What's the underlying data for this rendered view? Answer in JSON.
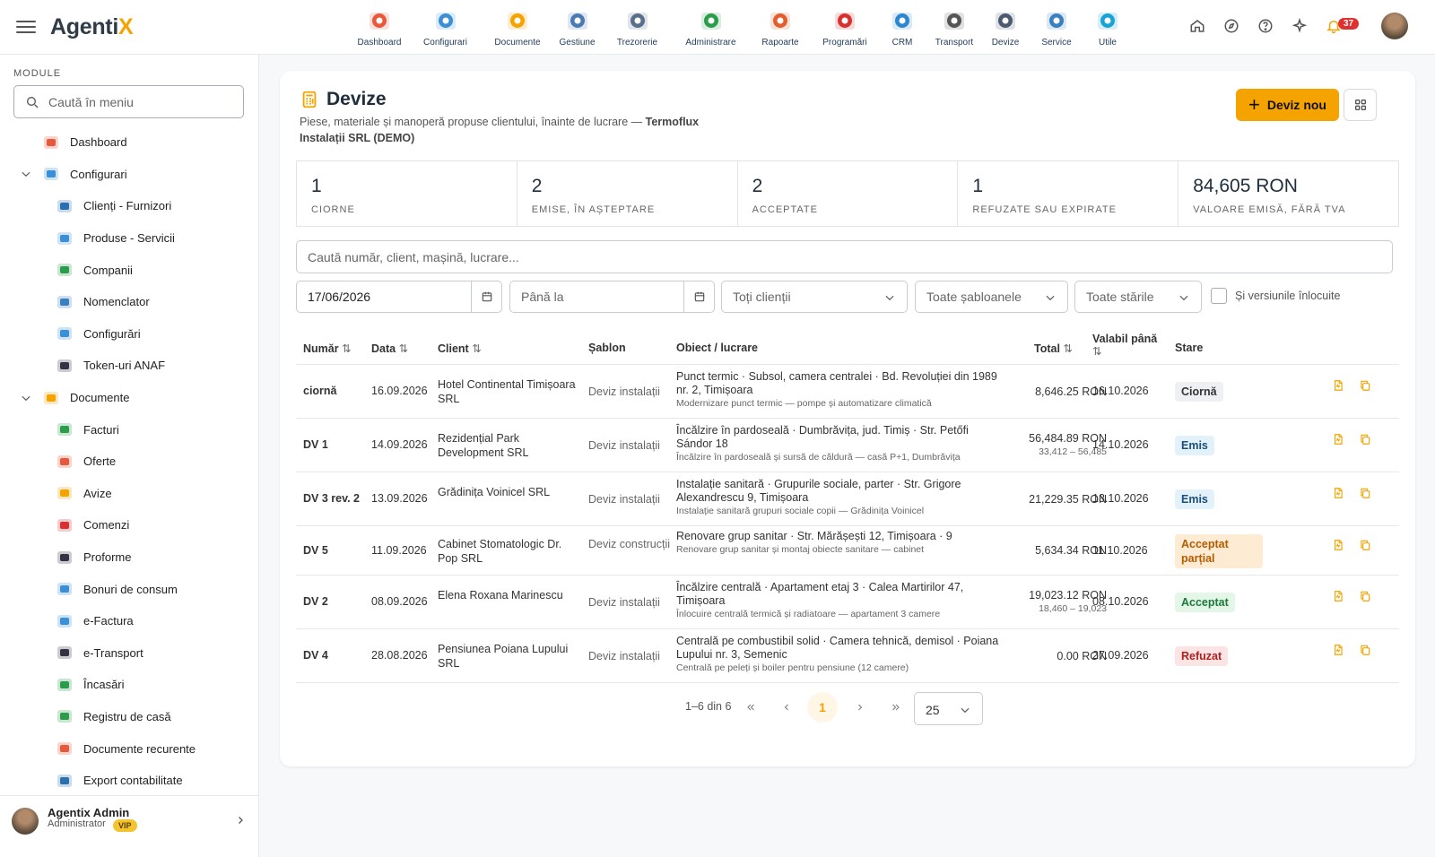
{
  "app": {
    "logo_main": "Agenti",
    "logo_x": "X"
  },
  "modules": [
    {
      "label": "Dashboard",
      "icon": "dashboard-chart-icon"
    },
    {
      "label": "Configurari",
      "icon": "wrench-gear-icon"
    },
    {
      "label": "Documente",
      "icon": "documents-icon"
    },
    {
      "label": "Gestiune",
      "icon": "warehouse-icon"
    },
    {
      "label": "Trezorerie",
      "icon": "bank-icon"
    },
    {
      "label": "Administrare",
      "icon": "shield-check-icon"
    },
    {
      "label": "Rapoarte",
      "icon": "report-pie-icon"
    },
    {
      "label": "Programări",
      "icon": "clock-icon"
    },
    {
      "label": "CRM",
      "icon": "crm-cycle-icon"
    },
    {
      "label": "Transport",
      "icon": "truck-icon"
    },
    {
      "label": "Devize",
      "icon": "estimate-doc-icon"
    },
    {
      "label": "Service",
      "icon": "car-service-icon"
    },
    {
      "label": "Utile",
      "icon": "help-circle-icon"
    }
  ],
  "notifications": {
    "count": "37"
  },
  "sidebar": {
    "heading": "MODULE",
    "search_placeholder": "Caută în meniu",
    "items": [
      {
        "label": "Dashboard",
        "level": "top"
      },
      {
        "label": "Configurari",
        "level": "group"
      },
      {
        "label": "Clienți - Furnizori",
        "level": "child"
      },
      {
        "label": "Produse - Servicii",
        "level": "child"
      },
      {
        "label": "Companii",
        "level": "child"
      },
      {
        "label": "Nomenclator",
        "level": "child"
      },
      {
        "label": "Configurări",
        "level": "child"
      },
      {
        "label": "Token-uri ANAF",
        "level": "child"
      },
      {
        "label": "Documente",
        "level": "group"
      },
      {
        "label": "Facturi",
        "level": "child"
      },
      {
        "label": "Oferte",
        "level": "child"
      },
      {
        "label": "Avize",
        "level": "child"
      },
      {
        "label": "Comenzi",
        "level": "child"
      },
      {
        "label": "Proforme",
        "level": "child"
      },
      {
        "label": "Bonuri de consum",
        "level": "child"
      },
      {
        "label": "e-Factura",
        "level": "child"
      },
      {
        "label": "e-Transport",
        "level": "child"
      },
      {
        "label": "Încasări",
        "level": "child"
      },
      {
        "label": "Registru de casă",
        "level": "child"
      },
      {
        "label": "Documente recurente",
        "level": "child"
      },
      {
        "label": "Export contabilitate",
        "level": "child"
      }
    ],
    "user": {
      "name": "Agentix Admin",
      "role": "Administrator",
      "badge": "VIP"
    }
  },
  "page": {
    "title": "Devize",
    "subtitle": "Piese, materiale și manoperă propuse clientului, înainte de lucrare —",
    "company": "Termoflux Instalații SRL (DEMO)",
    "new_button": "Deviz nou"
  },
  "stats": [
    {
      "value": "1",
      "label": "CIORNE"
    },
    {
      "value": "2",
      "label": "EMISE, ÎN AȘTEPTARE"
    },
    {
      "value": "2",
      "label": "ACCEPTATE"
    },
    {
      "value": "1",
      "label": "REFUZATE SAU EXPIRATE"
    },
    {
      "value": "84,605 RON",
      "label": "VALOARE EMISĂ, FĂRĂ TVA"
    }
  ],
  "search_placeholder": "Caută număr, client, mașină, lucrare...",
  "filters": {
    "date_from": "17/06/2026",
    "date_to_placeholder": "Până la",
    "clients": "Toți clienții",
    "templates": "Toate șabloanele",
    "states": "Toate stările",
    "replaced_label": "Și versiunile înlocuite"
  },
  "table": {
    "headers": {
      "num": "Număr",
      "date": "Data",
      "client": "Client",
      "template": "Șablon",
      "object": "Obiect / lucrare",
      "total": "Total",
      "valid1": "Valabil până",
      "state": "Stare"
    },
    "rows": [
      {
        "num": "ciornă",
        "date": "16.09.2026",
        "client": "Hotel Continental Timișoara SRL",
        "template": "Deviz instalații",
        "obj": "Punct termic · Subsol, camera centralei · Bd. Revoluției din 1989 nr. 2, Timișoara",
        "obj_sub": "Modernizare punct termic — pompe și automatizare climatică",
        "total": "8,646.25 RON",
        "total_sub": "",
        "valid": "16.10.2026",
        "state": "Ciornă",
        "state_bg": "#eef0f3",
        "state_fg": "#333"
      },
      {
        "num": "DV 1",
        "date": "14.09.2026",
        "client": "Rezidențial Park Development SRL",
        "template": "Deviz instalații",
        "obj": "Încălzire în pardoseală · Dumbrăvița, jud. Timiș · Str. Petőfi Sándor 18",
        "obj_sub": "Încălzire în pardoseală și sursă de căldură — casă P+1, Dumbrăvița",
        "total": "56,484.89 RON",
        "total_sub": "33,412 – 56,485",
        "valid": "14.10.2026",
        "state": "Emis",
        "state_bg": "#e3f1fb",
        "state_fg": "#1c4f7a"
      },
      {
        "num": "DV 3 rev. 2",
        "date": "13.09.2026",
        "client": "Grădinița Voinicel SRL",
        "template": "Deviz instalații",
        "obj": "Instalație sanitară · Grupurile sociale, parter · Str. Grigore Alexandrescu 9, Timișoara",
        "obj_sub": "Instalație sanitară grupuri sociale copii — Grădinița Voinicel",
        "total": "21,229.35 RON",
        "total_sub": "",
        "valid": "13.10.2026",
        "state": "Emis",
        "state_bg": "#e3f1fb",
        "state_fg": "#1c4f7a"
      },
      {
        "num": "DV 5",
        "date": "11.09.2026",
        "client": "Cabinet Stomatologic Dr. Pop SRL",
        "template": "Deviz construcții",
        "obj": "Renovare grup sanitar · Str. Mărășești 12, Timișoara · 9",
        "obj_sub": "Renovare grup sanitar și montaj obiecte sanitare — cabinet",
        "total": "5,634.34 RON",
        "total_sub": "",
        "valid": "11.10.2026",
        "state": "Acceptat parțial",
        "state_bg": "#fdebd3",
        "state_fg": "#b35c00"
      },
      {
        "num": "DV 2",
        "date": "08.09.2026",
        "client": "Elena Roxana Marinescu",
        "template": "Deviz instalații",
        "obj": "Încălzire centrală · Apartament etaj 3 · Calea Martirilor 47, Timișoara",
        "obj_sub": "Înlocuire centrală termică și radiatoare — apartament 3 camere",
        "total": "19,023.12 RON",
        "total_sub": "18,460 – 19,023",
        "valid": "08.10.2026",
        "state": "Acceptat",
        "state_bg": "#e3f6e8",
        "state_fg": "#1d7a3a"
      },
      {
        "num": "DV 4",
        "date": "28.08.2026",
        "client": "Pensiunea Poiana Lupului SRL",
        "template": "Deviz instalații",
        "obj": "Centrală pe combustibil solid · Camera tehnică, demisol · Poiana Lupului nr. 3, Semenic",
        "obj_sub": "Centrală pe peleți și boiler pentru pensiune (12 camere)",
        "total": "0.00 RON",
        "total_sub": "",
        "valid": "27.09.2026",
        "state": "Refuzat",
        "state_bg": "#fde4e4",
        "state_fg": "#b02020"
      }
    ]
  },
  "pagination": {
    "range": "1–6 din 6",
    "page": "1",
    "per_page": "25"
  },
  "colors": {
    "accent": "#f5a300",
    "brand_dark": "#2f3b46"
  }
}
